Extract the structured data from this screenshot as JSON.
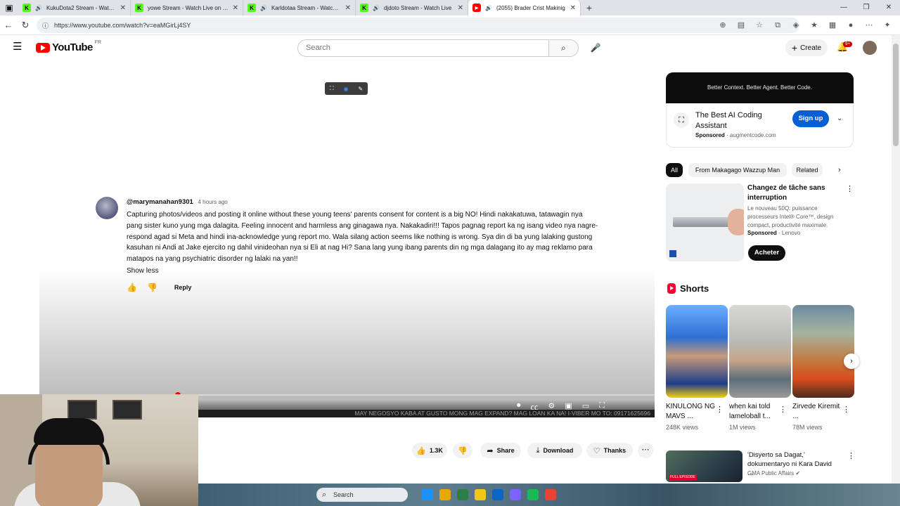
{
  "browser": {
    "tabs": [
      {
        "title": "KukuDota2 Stream - Watch Live",
        "favicon": "kick",
        "audio": true
      },
      {
        "title": "yowe Stream - Watch Live on Kick",
        "favicon": "kick",
        "audio": false
      },
      {
        "title": "Karldotaa Stream - Watch Live",
        "favicon": "kick",
        "audio": true
      },
      {
        "title": "djdoto Stream - Watch Live",
        "favicon": "kick",
        "audio": true
      },
      {
        "title": "(2055) Brader Crist Makinig",
        "favicon": "youtube",
        "audio": true,
        "active": true
      }
    ],
    "url": "https://www.youtube.com/watch?v=eaMGirLj4SY"
  },
  "yt": {
    "logo_text": "YouTube",
    "region": "FR",
    "search_placeholder": "Search",
    "create_label": "Create",
    "notif_count": "9+"
  },
  "comment": {
    "handle": "@marymanahan9301",
    "time": "4 hours ago",
    "text": "Capturing photos/videos and posting it online without these young teens' parents consent for content is a big NO! Hindi nakakatuwa, tatawagin nya pang sister kuno yung mga dalagita. Feeling innocent and harmless ang ginagawa nya. Nakakadiri!!! Tapos pagnag report ka ng isang video nya nagre-respond agad si Meta and hindi ina-acknowledge yung report mo. Wala silang action seems like nothing is wrong. Sya din di ba yung lalaking gustong kasuhan ni Andi at Jake ejercito ng dahil vinideohan nya si Eli at nag Hi? Sana lang yung ibang parents din ng mga dalagang ito ay mag reklamo para matapos na yang psychiatric disorder ng lalaki na yan!!",
    "show_less": "Show less",
    "reply_label": "Reply"
  },
  "player": {
    "ticker": "MAY NEGOSYO KABA AT GUSTO MONG MAG EXPAND? MAG LOAN KA NA! I-VIBER MO TO: 09171625696",
    "progress": 0.22
  },
  "video_actions": {
    "likes": "1.3K",
    "share": "Share",
    "download": "Download",
    "thanks": "Thanks"
  },
  "taskbar": {
    "search": "Search",
    "icon_colors": [
      "#1e90ff",
      "#e6a700",
      "#2d7d46",
      "#f5c518",
      "#0a66c2",
      "#7b61ff",
      "#1db954",
      "#ea4335"
    ]
  },
  "ad": {
    "banner": "Better Context. Better Agent. Better Code.",
    "title": "The Best AI Coding Assistant",
    "sponsored": "Sponsored",
    "domain": "augmentcode.com",
    "cta": "Sign up"
  },
  "chips": [
    "All",
    "From Makagago Wazzup Man",
    "Related"
  ],
  "lenovo": {
    "title": "Changez de tâche sans interruption",
    "desc": "Le nouveau 50Q: puissance processeurs Intel® Core™, design compact, productivité maximale.",
    "sponsored": "Sponsored",
    "brand": "Lenovo",
    "cta": "Acheter"
  },
  "shorts": {
    "heading": "Shorts",
    "items": [
      {
        "title": "KINULONG NG MAVS ...",
        "views": "248K views"
      },
      {
        "title": "when kai told lameloball t...",
        "views": "1M views"
      },
      {
        "title": "Zirvede Kiremit ...",
        "views": "78M views"
      }
    ]
  },
  "gma": {
    "title": "'Disyerto sa Dagat,' dokumentaryo ni Kara David ...",
    "channel": "GMA Public Affairs",
    "thumb_label": "FULL EPISODE"
  }
}
